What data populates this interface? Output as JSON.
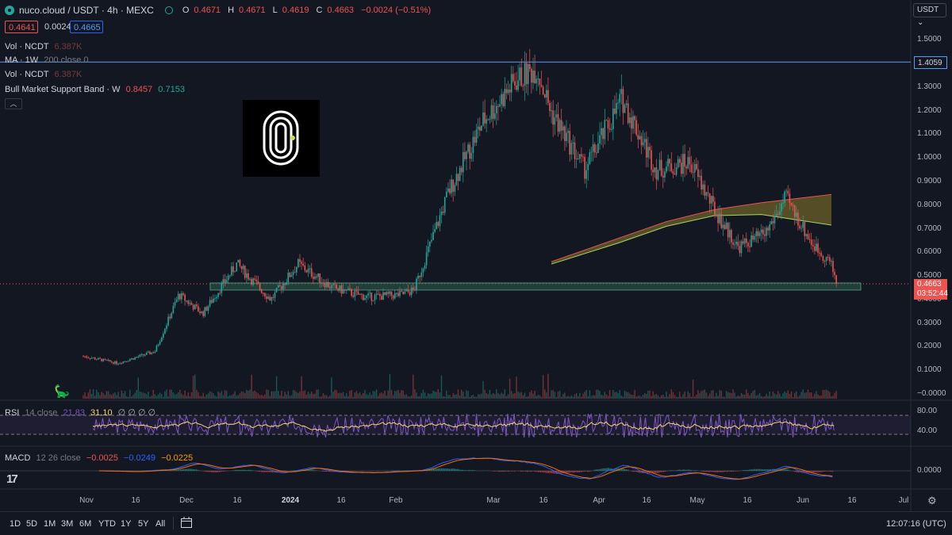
{
  "header": {
    "symbol": "nuco.cloud / USDT · 4h · MEXC",
    "ohlc": [
      {
        "label": "O",
        "value": "0.4671"
      },
      {
        "label": "H",
        "value": "0.4671"
      },
      {
        "label": "L",
        "value": "0.4619"
      },
      {
        "label": "C",
        "value": "0.4663"
      }
    ],
    "change": "−0.0024 (−0.51%)",
    "bid": "0.4641",
    "spread": "0.0024",
    "ask": "0.4665"
  },
  "indicators": {
    "vol1": {
      "name": "Vol · NCDT",
      "value": "6.387K"
    },
    "ma": {
      "name": "MA · 1W",
      "params": "200 close 0"
    },
    "vol2": {
      "name": "Vol · NCDT",
      "value": "6.387K"
    },
    "bmsb": {
      "name": "Bull Market Support Band · W",
      "v1": "0.8457",
      "v2": "0.7153"
    },
    "rsi": {
      "name": "RSI",
      "params": "14 close",
      "v1": "21.83",
      "v2": "31.10",
      "extra": "∅ ∅ ∅ ∅"
    },
    "macd": {
      "name": "MACD",
      "params": "12 26 close",
      "v1": "−0.0025",
      "v2": "−0.0249",
      "v3": "−0.0225"
    }
  },
  "price_axis": {
    "currency": "USDT",
    "labels": [
      "1.5000",
      "1.4000",
      "1.3000",
      "1.2000",
      "1.1000",
      "1.0000",
      "0.9000",
      "0.8000",
      "0.7000",
      "0.6000",
      "0.5000",
      "0.4000",
      "0.3000",
      "0.2000",
      "0.1000",
      "−0.0000"
    ],
    "high_line_label": "1.4059",
    "current_price": "0.4663",
    "countdown": "03:52:44",
    "rsi_labels": [
      "80.00",
      "40.00"
    ],
    "macd_label": "0.0000"
  },
  "time_axis": [
    "Nov",
    "16",
    "Dec",
    "16",
    "2024",
    "16",
    "Feb",
    "Mar",
    "16",
    "Apr",
    "16",
    "May",
    "16",
    "Jun",
    "16",
    "Jul"
  ],
  "bottom": {
    "timeframes": [
      "1D",
      "5D",
      "1M",
      "3M",
      "6M",
      "YTD",
      "1Y",
      "5Y",
      "All"
    ],
    "clock": "12:07:16 (UTC)"
  },
  "colors": {
    "background": "#131722",
    "up": "#26a69a",
    "down": "#ef5350",
    "high_line": "#5b9cf6",
    "support_band": "#2e5f4f",
    "bmsb_fill": "#8b7a2a"
  },
  "chart_data": {
    "type": "candlestick",
    "interval": "4h",
    "x": [
      "2023-10-31",
      "2023-11-10",
      "2023-11-21",
      "2023-11-28",
      "2023-12-05",
      "2023-12-15",
      "2023-12-25",
      "2024-01-02",
      "2024-01-12",
      "2024-01-22",
      "2024-02-01",
      "2024-02-05",
      "2024-02-15",
      "2024-02-25",
      "2024-03-06",
      "2024-03-12",
      "2024-03-16",
      "2024-03-26",
      "2024-04-06",
      "2024-04-16",
      "2024-04-26",
      "2024-05-03",
      "2024-05-10",
      "2024-05-18",
      "2024-05-24",
      "2024-06-01",
      "2024-06-06",
      "2024-06-08"
    ],
    "close": [
      0.16,
      0.13,
      0.18,
      0.42,
      0.34,
      0.55,
      0.4,
      0.55,
      0.45,
      0.41,
      0.42,
      0.44,
      0.85,
      1.15,
      1.33,
      1.38,
      1.2,
      0.95,
      1.25,
      0.95,
      0.98,
      0.78,
      0.62,
      0.68,
      0.83,
      0.63,
      0.56,
      0.4663
    ],
    "ylim": [
      0,
      1.55
    ],
    "resistance": 1.4059,
    "support_zone": [
      0.44,
      0.47
    ],
    "bull_market_support_band": {
      "upper": 0.8457,
      "lower": 0.7153
    },
    "rsi_last": [
      21.83,
      31.1
    ],
    "macd_last": {
      "macd": -0.0025,
      "signal": -0.0249,
      "hist": -0.0225
    }
  }
}
